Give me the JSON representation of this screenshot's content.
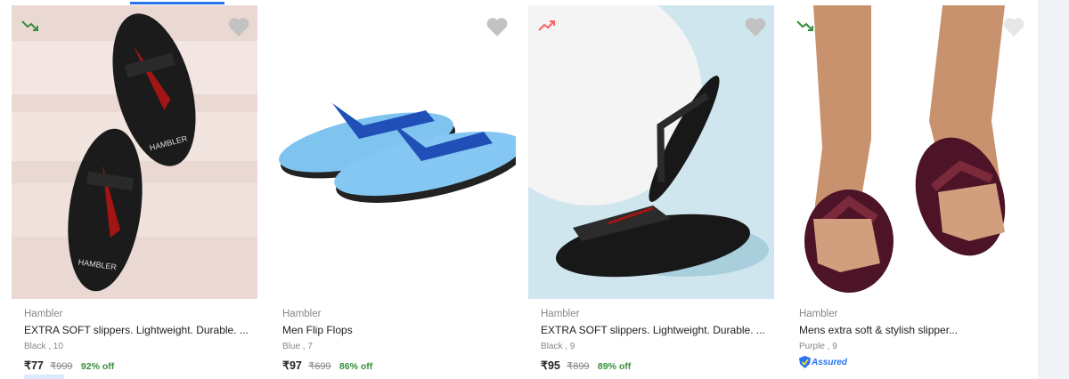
{
  "products": [
    {
      "brand": "Hambler",
      "title": "EXTRA SOFT slippers. Lightweight. Durable. ...",
      "variant": "Black , 10",
      "price": "₹77",
      "mrp": "₹999",
      "discount": "92% off",
      "trend_icon": "trend-down-icon",
      "trend_color": "#388e3c",
      "image_bg": "#ead8d3"
    },
    {
      "brand": "Hambler",
      "title": "Men Flip Flops",
      "variant": "Blue , 7",
      "price": "₹97",
      "mrp": "₹699",
      "discount": "86% off",
      "image_bg": "#ffffff"
    },
    {
      "brand": "Hambler",
      "title": "EXTRA SOFT slippers. Lightweight. Durable. ...",
      "variant": "Black , 9",
      "price": "₹95",
      "mrp": "₹899",
      "discount": "89% off",
      "trend_icon": "trend-up-icon",
      "trend_color": "#ff6161",
      "image_bg": "#cfe6ee"
    },
    {
      "brand": "Hambler",
      "title": "Mens extra soft & stylish slipper...",
      "variant": "Purple , 9",
      "assured_label": "Assured",
      "trend_icon": "trend-down-icon",
      "trend_color": "#388e3c",
      "image_bg": "#ffffff"
    }
  ],
  "colors": {
    "accent": "#2874f0",
    "discount_green": "#388e3c",
    "heart_gray": "#c2c2c2"
  }
}
